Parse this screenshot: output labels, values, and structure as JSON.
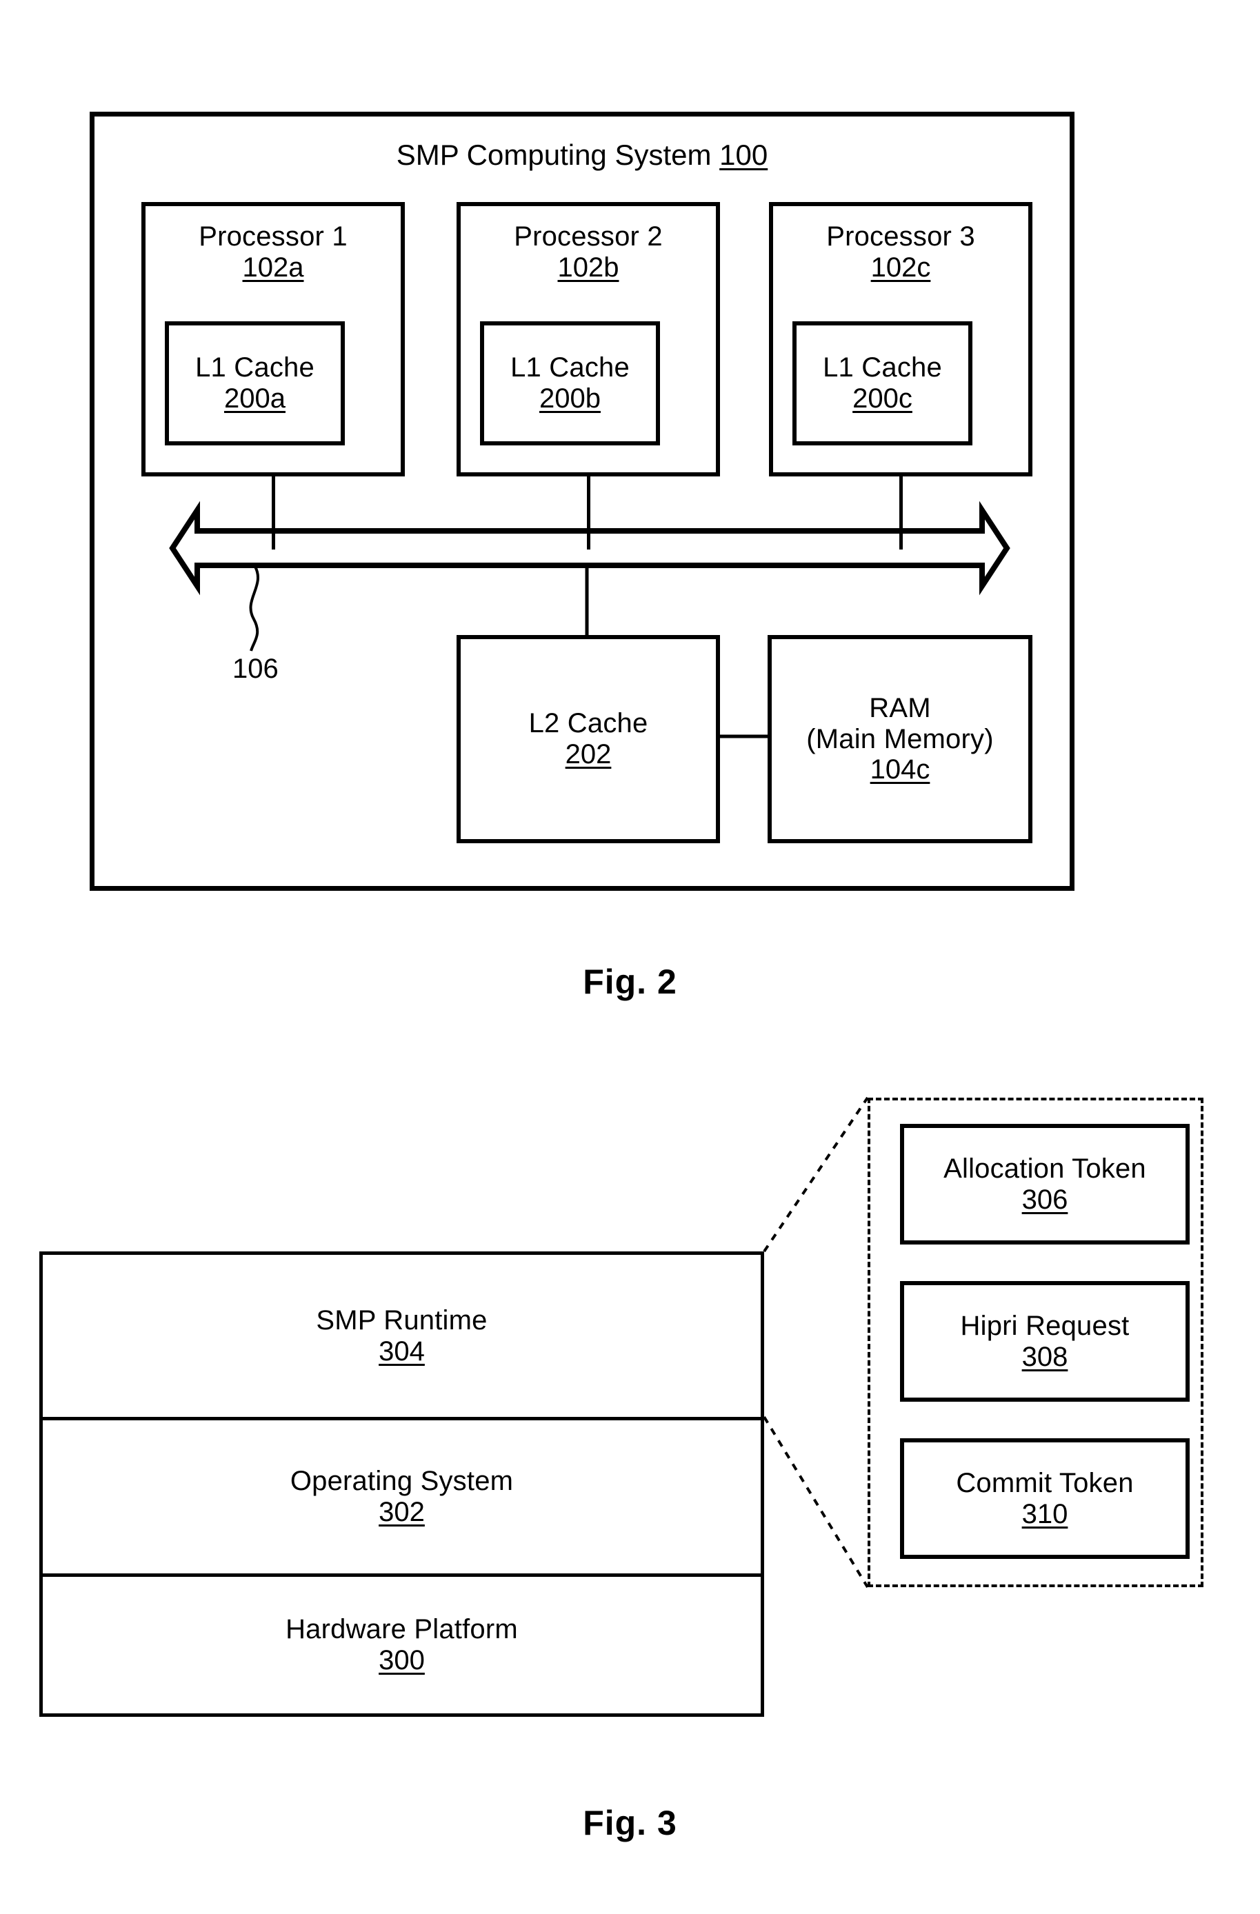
{
  "figure2": {
    "caption": "Fig. 2",
    "system": {
      "title": "SMP Computing System",
      "ref": "100"
    },
    "processors": [
      {
        "label": "Processor 1",
        "ref": "102a",
        "cache_label": "L1 Cache",
        "cache_ref": "200a"
      },
      {
        "label": "Processor 2",
        "ref": "102b",
        "cache_label": "L1 Cache",
        "cache_ref": "200b"
      },
      {
        "label": "Processor 3",
        "ref": "102c",
        "cache_label": "L1 Cache",
        "cache_ref": "200c"
      }
    ],
    "bus": {
      "ref": "106"
    },
    "l2_cache": {
      "label": "L2 Cache",
      "ref": "202"
    },
    "ram": {
      "label_line1": "RAM",
      "label_line2": "(Main Memory)",
      "ref": "104c"
    }
  },
  "figure3": {
    "caption": "Fig. 3",
    "stack": [
      {
        "label": "SMP Runtime",
        "ref": "304"
      },
      {
        "label": "Operating System",
        "ref": "302"
      },
      {
        "label": "Hardware Platform",
        "ref": "300"
      }
    ],
    "callout_items": [
      {
        "label": "Allocation Token",
        "ref": "306"
      },
      {
        "label": "Hipri Request",
        "ref": "308"
      },
      {
        "label": "Commit Token",
        "ref": "310"
      }
    ]
  }
}
